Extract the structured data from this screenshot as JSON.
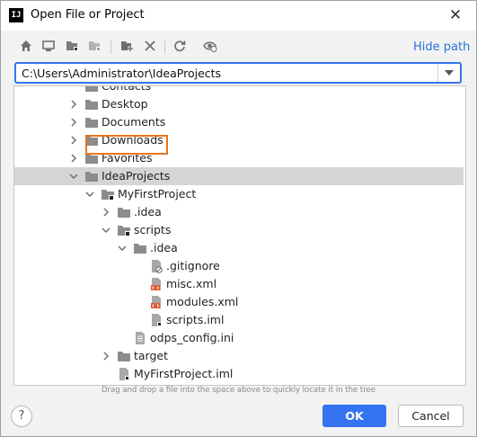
{
  "window": {
    "title": "Open File or Project",
    "app_icon": "IJ"
  },
  "toolbar": {
    "buttons": [
      "home-icon",
      "desktop-icon",
      "project-folder-icon",
      "module-folder-icon",
      "new-folder-icon",
      "delete-icon",
      "refresh-icon",
      "show-hidden-icon"
    ],
    "hide_path": "Hide path"
  },
  "path": {
    "value": "C:\\Users\\Administrator\\IdeaProjects"
  },
  "tree": {
    "rows": [
      {
        "label": "Contacts",
        "depth": 0,
        "chevron": "none",
        "icon": "folder"
      },
      {
        "label": "Desktop",
        "depth": 0,
        "chevron": "right",
        "icon": "folder"
      },
      {
        "label": "Documents",
        "depth": 0,
        "chevron": "right",
        "icon": "folder"
      },
      {
        "label": "Downloads",
        "depth": 0,
        "chevron": "right",
        "icon": "folder"
      },
      {
        "label": "Favorites",
        "depth": 0,
        "chevron": "right",
        "icon": "folder"
      },
      {
        "label": "IdeaProjects",
        "depth": 0,
        "chevron": "down",
        "icon": "folder",
        "selected": true
      },
      {
        "label": "MyFirstProject",
        "depth": 1,
        "chevron": "down",
        "icon": "project-folder"
      },
      {
        "label": ".idea",
        "depth": 2,
        "chevron": "right",
        "icon": "folder"
      },
      {
        "label": "scripts",
        "depth": 2,
        "chevron": "down",
        "icon": "project-folder",
        "highlighted": true
      },
      {
        "label": ".idea",
        "depth": 3,
        "chevron": "down",
        "icon": "folder"
      },
      {
        "label": ".gitignore",
        "depth": 4,
        "chevron": "none",
        "icon": "gitignore-file"
      },
      {
        "label": "misc.xml",
        "depth": 4,
        "chevron": "none",
        "icon": "xml-file"
      },
      {
        "label": "modules.xml",
        "depth": 4,
        "chevron": "none",
        "icon": "xml-file"
      },
      {
        "label": "scripts.iml",
        "depth": 4,
        "chevron": "none",
        "icon": "iml-file"
      },
      {
        "label": "odps_config.ini",
        "depth": 3,
        "chevron": "none",
        "icon": "text-file"
      },
      {
        "label": "target",
        "depth": 2,
        "chevron": "right",
        "icon": "folder"
      },
      {
        "label": "MyFirstProject.iml",
        "depth": 2,
        "chevron": "none",
        "icon": "iml-file"
      }
    ]
  },
  "hint": "Drag and drop a file into the space above to quickly locate it in the tree",
  "buttons": {
    "help": "?",
    "ok": "OK",
    "cancel": "Cancel"
  },
  "colors": {
    "accent": "#3574f0",
    "highlight": "#e8761e",
    "link": "#2d72d9"
  }
}
